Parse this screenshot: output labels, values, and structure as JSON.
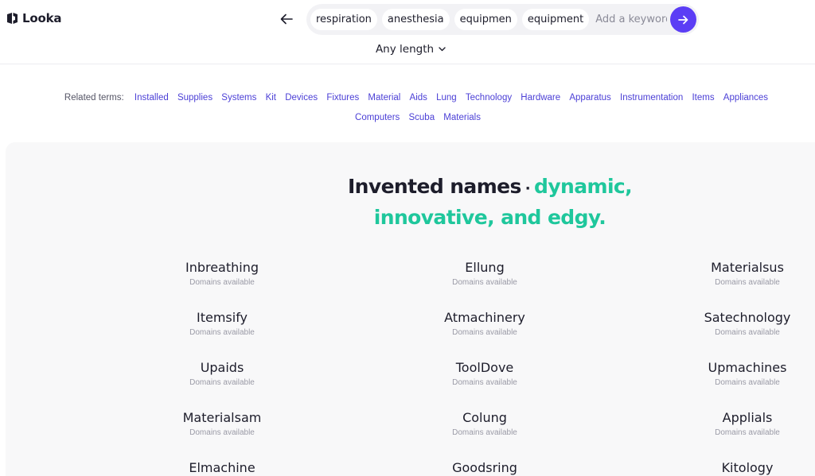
{
  "brand": {
    "name": "Looka"
  },
  "search": {
    "chips": [
      "respiration",
      "anesthesia",
      "equipmen",
      "equipment"
    ],
    "placeholder": "Add a keyword"
  },
  "length": {
    "label": "Any length"
  },
  "related": {
    "label": "Related terms:",
    "row1": [
      "Installed",
      "Supplies",
      "Systems",
      "Kit",
      "Devices",
      "Fixtures",
      "Material",
      "Aids",
      "Lung",
      "Technology",
      "Hardware",
      "Apparatus",
      "Instrumentation",
      "Items",
      "Appliances"
    ],
    "row2": [
      "Computers",
      "Scuba",
      "Materials"
    ]
  },
  "results": {
    "title_main": "Invented names",
    "title_accent_1": "dynamic,",
    "title_accent_2": "innovative, and edgy.",
    "names": [
      {
        "name": "Inbreathing",
        "status": "Domains available"
      },
      {
        "name": "Ellung",
        "status": "Domains available"
      },
      {
        "name": "Materialsus",
        "status": "Domains available"
      },
      {
        "name": "Itemsify",
        "status": "Domains available"
      },
      {
        "name": "Atmachinery",
        "status": "Domains available"
      },
      {
        "name": "Satechnology",
        "status": "Domains available"
      },
      {
        "name": "Upaids",
        "status": "Domains available"
      },
      {
        "name": "ToolDove",
        "status": "Domains available"
      },
      {
        "name": "Upmachines",
        "status": "Domains available"
      },
      {
        "name": "Materialsam",
        "status": "Domains available"
      },
      {
        "name": "Colung",
        "status": "Domains available"
      },
      {
        "name": "Applials",
        "status": "Domains available"
      },
      {
        "name": "Elmachine",
        "status": ""
      },
      {
        "name": "Goodsring",
        "status": ""
      },
      {
        "name": "Kitology",
        "status": ""
      }
    ]
  },
  "colors": {
    "accent": "#5b3df5",
    "highlight": "#1fc79c",
    "link": "#4b3fd6"
  },
  "icons": {
    "back": "arrow-left-icon",
    "go": "arrow-right-icon",
    "length": "chevron-down-icon",
    "logo": "looka-logo-icon"
  }
}
